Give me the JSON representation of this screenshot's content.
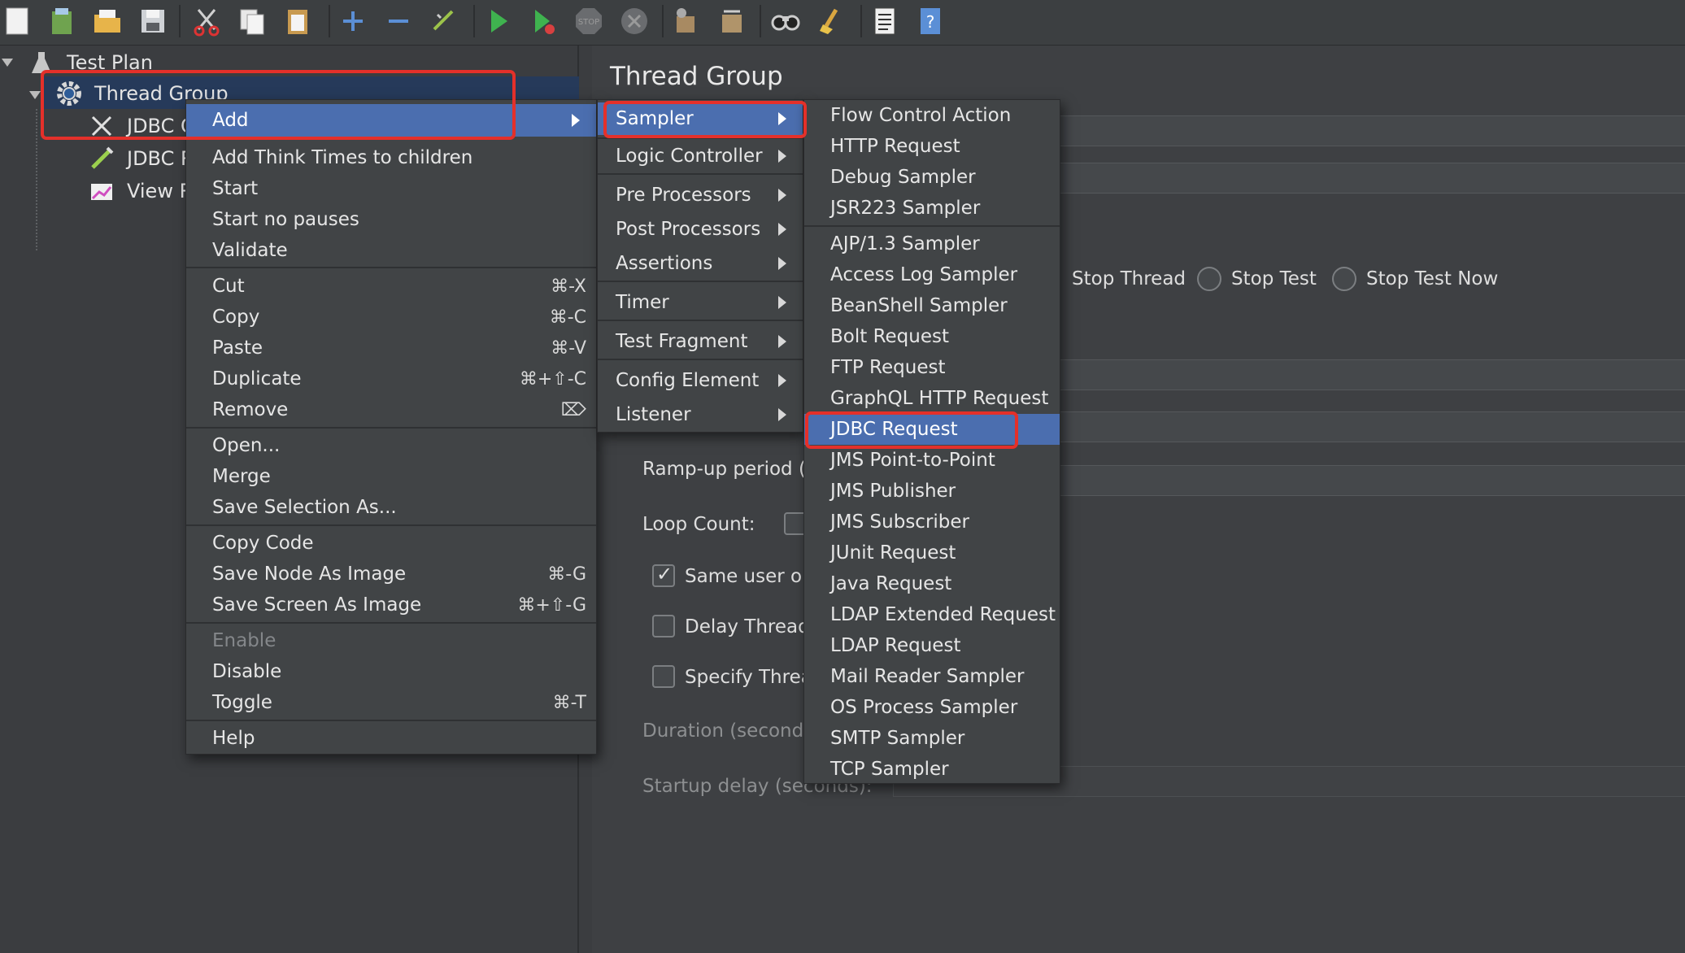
{
  "toolbar": {
    "icons": [
      "new-icon",
      "templates-icon",
      "open-icon",
      "save-icon",
      "cut-icon",
      "copy-icon",
      "paste-icon",
      "expand-icon",
      "collapse-icon",
      "toggle-icon",
      "start-icon",
      "start-no-pauses-icon",
      "stop-icon",
      "shutdown-icon",
      "clear-icon",
      "clear-all-icon",
      "search-icon",
      "reset-search-icon",
      "function-helper-icon",
      "help-icon"
    ]
  },
  "tree": {
    "test_plan": "Test Plan",
    "thread_group": "Thread Group",
    "child1": "JDBC C",
    "child2": "JDBC R",
    "child3": "View R"
  },
  "panel": {
    "title": "Thread Group",
    "stop_thread": "Stop Thread",
    "stop_test": "Stop Test",
    "stop_test_now": "Stop Test Now",
    "ramp_up": "Ramp-up period (s",
    "loop_count": "Loop Count:",
    "same_user": "Same user on",
    "delay_thread": "Delay Thread",
    "specify_thread": "Specify Threa",
    "duration": "Duration (seconds)",
    "startup_delay": "Startup delay (seconds):"
  },
  "context_menu": {
    "add": "Add",
    "add_think_times": "Add Think Times to children",
    "start": "Start",
    "start_no_pauses": "Start no pauses",
    "validate": "Validate",
    "cut": "Cut",
    "cut_sc": "⌘-X",
    "copy": "Copy",
    "copy_sc": "⌘-C",
    "paste": "Paste",
    "paste_sc": "⌘-V",
    "duplicate": "Duplicate",
    "duplicate_sc": "⌘+⇧-C",
    "remove": "Remove",
    "remove_sc": "⌦",
    "open": "Open...",
    "merge": "Merge",
    "save_selection": "Save Selection As...",
    "copy_code": "Copy Code",
    "save_node_image": "Save Node As Image",
    "save_node_image_sc": "⌘-G",
    "save_screen_image": "Save Screen As Image",
    "save_screen_image_sc": "⌘+⇧-G",
    "enable": "Enable",
    "disable": "Disable",
    "toggle": "Toggle",
    "toggle_sc": "⌘-T",
    "help": "Help"
  },
  "add_menu": {
    "sampler": "Sampler",
    "logic_controller": "Logic Controller",
    "pre_processors": "Pre Processors",
    "post_processors": "Post Processors",
    "assertions": "Assertions",
    "timer": "Timer",
    "test_fragment": "Test Fragment",
    "config_element": "Config Element",
    "listener": "Listener"
  },
  "sampler_menu": {
    "items_top": [
      "Flow Control Action",
      "HTTP Request",
      "Debug Sampler",
      "JSR223 Sampler"
    ],
    "items_bottom": [
      "AJP/1.3 Sampler",
      "Access Log Sampler",
      "BeanShell Sampler",
      "Bolt Request",
      "FTP Request",
      "GraphQL HTTP Request",
      "JDBC Request",
      "JMS Point-to-Point",
      "JMS Publisher",
      "JMS Subscriber",
      "JUnit Request",
      "Java Request",
      "LDAP Extended Request",
      "LDAP Request",
      "Mail Reader Sampler",
      "OS Process Sampler",
      "SMTP Sampler",
      "TCP Sampler"
    ],
    "selected": "JDBC Request"
  },
  "colors": {
    "highlight": "#4b6eaf",
    "annotation": "#e4302a"
  }
}
